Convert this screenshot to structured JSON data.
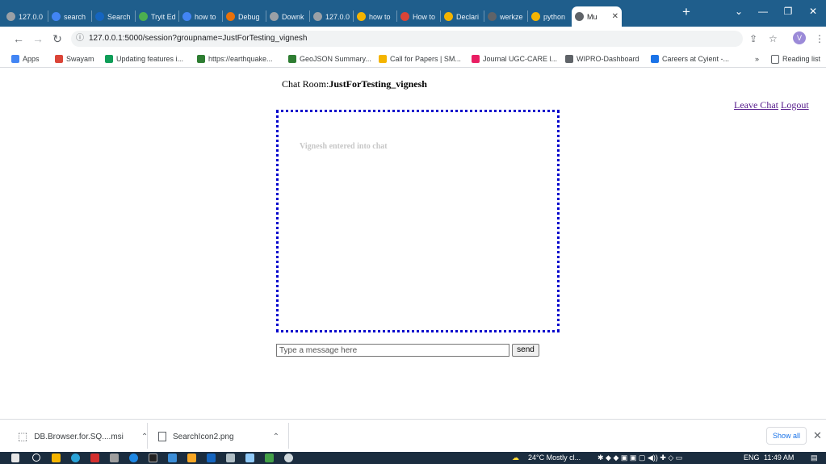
{
  "browser": {
    "tabs": [
      {
        "label": "127.0.0",
        "icon": "globe-icon",
        "color": "#9aa0a6"
      },
      {
        "label": "search",
        "icon": "google-icon",
        "color": "#4285f4"
      },
      {
        "label": "Search",
        "icon": "flask-icon",
        "color": "#1565c0"
      },
      {
        "label": "Tryit Ed",
        "icon": "w3-icon",
        "color": "#4caf50"
      },
      {
        "label": "how to",
        "icon": "google-icon",
        "color": "#4285f4"
      },
      {
        "label": "Debug",
        "icon": "stack-icon",
        "color": "#e8710a"
      },
      {
        "label": "Downk",
        "icon": "doc-icon",
        "color": "#9aa0a6"
      },
      {
        "label": "127.0.0",
        "icon": "globe-icon",
        "color": "#9aa0a6"
      },
      {
        "label": "how to",
        "icon": "python-icon",
        "color": "#f4b400"
      },
      {
        "label": "How to",
        "icon": "red-icon",
        "color": "#db4437"
      },
      {
        "label": "Declari",
        "icon": "python-icon",
        "color": "#f4b400"
      },
      {
        "label": "werkze",
        "icon": "terminal-icon",
        "color": "#5f6368"
      },
      {
        "label": "python",
        "icon": "python-icon",
        "color": "#f4b400"
      },
      {
        "label": "Mu",
        "icon": "globe-icon",
        "color": "#5f6368",
        "active": true
      }
    ],
    "url": "127.0.0.1:5000/session?groupname=JustForTesting_vignesh",
    "profile_initial": "V",
    "bookmarks": [
      {
        "label": "Apps",
        "color": "#4285f4"
      },
      {
        "label": "Swayam",
        "color": "#db4437"
      },
      {
        "label": "Updating features i...",
        "color": "#0f9d58"
      },
      {
        "label": "https://earthquake...",
        "color": "#2e7d32"
      },
      {
        "label": "GeoJSON Summary...",
        "color": "#2e7d32"
      },
      {
        "label": "Call for Papers | SM...",
        "color": "#f4b400"
      },
      {
        "label": "Journal UGC-CARE l...",
        "color": "#e91e63"
      },
      {
        "label": "WIPRO-Dashboard",
        "color": "#5f6368"
      },
      {
        "label": "Careers at Cyient -...",
        "color": "#1a73e8"
      }
    ],
    "reading_list": "Reading list",
    "more_bookmarks": "»"
  },
  "page": {
    "room_prefix": "Chat Room:",
    "room_name": "JustForTesting_vignesh",
    "leave_chat": "Leave Chat",
    "logout": "Logout",
    "messages": [
      "Vignesh entered into chat"
    ],
    "input_placeholder": "Type a message here",
    "send_label": "send"
  },
  "downloads": {
    "items": [
      {
        "name": "DB.Browser.for.SQ....msi"
      },
      {
        "name": "SearchIcon2.png"
      }
    ],
    "show_all": "Show all"
  },
  "taskbar": {
    "weather": "24°C  Mostly cl...",
    "language": "ENG",
    "time": "11:49 AM"
  }
}
